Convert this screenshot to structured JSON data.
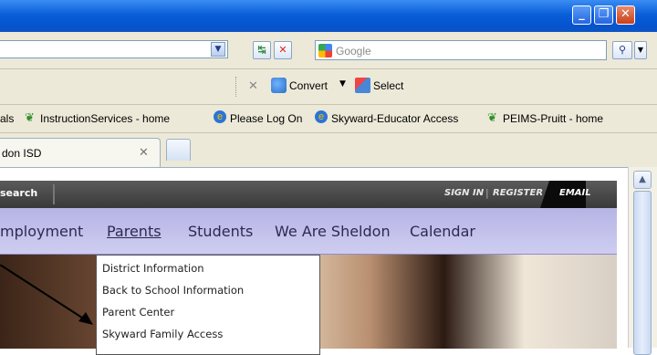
{
  "titlebar": {
    "controls": [
      "minimize-button",
      "maximize-button",
      "close-button"
    ]
  },
  "address": {
    "search_placeholder": "Google"
  },
  "toolbar": {
    "convert_label": "Convert",
    "select_label": "Select"
  },
  "favorites": {
    "items": [
      "als",
      "InstructionServices - home",
      "Please Log On",
      "Skyward-Educator Access",
      "PEIMS-Pruitt - home"
    ]
  },
  "tabs": {
    "active_title": "don ISD"
  },
  "site": {
    "search_label": "search",
    "sign_in": "SIGN IN",
    "register": "REGISTER",
    "email": "EMAIL",
    "nav": [
      "mployment",
      "Parents",
      "Students",
      "We Are Sheldon",
      "Calendar"
    ],
    "dropdown": [
      "District Information",
      "Back to School Information",
      "Parent Center",
      "Skyward Family Access"
    ]
  },
  "colors": {
    "titlebar": "#0a5fd8",
    "chrome": "#ece9d8",
    "navbar": "#cecdf0",
    "darkbar": "#393939"
  }
}
